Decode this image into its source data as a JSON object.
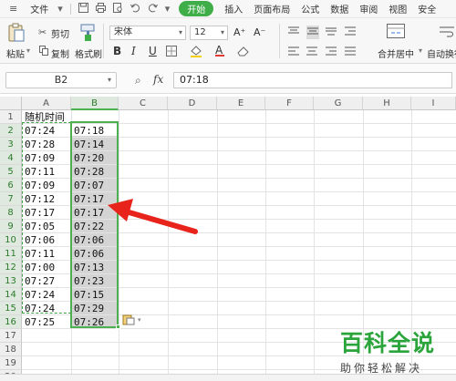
{
  "menubar": {
    "hamburger_icon": "≡",
    "file_label": "文件",
    "dropdown_icon": "▾",
    "quick_actions": [
      "save-icon",
      "print-icon",
      "preview-icon",
      "undo-icon",
      "redo-icon"
    ],
    "tabs": [
      "开始",
      "插入",
      "页面布局",
      "公式",
      "数据",
      "审阅",
      "视图",
      "安全"
    ],
    "active_tab": "开始",
    "accent_color": "#3fae49"
  },
  "ribbon": {
    "paste_label": "粘贴",
    "cut_label": "剪切",
    "copy_label": "复制",
    "format_painter_label": "格式刷",
    "font_name": "宋体",
    "font_size": "12",
    "font_grow": "A⁺",
    "font_shrink": "A⁻",
    "bold": "B",
    "italic": "I",
    "underline": "U",
    "font_color_letter": "A",
    "merge_label": "合并居中",
    "wrap_label": "自动换行"
  },
  "formula_bar": {
    "name_box": "B2",
    "formula_value": "07:18",
    "zoom_icon": "⌕",
    "fx_label": "fx"
  },
  "grid": {
    "columns": [
      "A",
      "B",
      "C",
      "D",
      "E",
      "F",
      "G",
      "H",
      "I"
    ],
    "rows": [
      "1",
      "2",
      "3",
      "4",
      "5",
      "6",
      "7",
      "8",
      "9",
      "10",
      "11",
      "12",
      "13",
      "14",
      "15",
      "16",
      "17",
      "18",
      "19",
      "20"
    ],
    "header_text": "随机时间",
    "col_a": [
      "07:24",
      "07:28",
      "07:09",
      "07:11",
      "07:09",
      "07:12",
      "07:17",
      "07:05",
      "07:06",
      "07:11",
      "07:00",
      "07:27",
      "07:24",
      "07:24",
      "07:25"
    ],
    "col_b": [
      "07:18",
      "07:14",
      "07:20",
      "07:28",
      "07:07",
      "07:17",
      "07:17",
      "07:22",
      "07:06",
      "07:06",
      "07:13",
      "07:23",
      "07:15",
      "07:29",
      "07:26"
    ],
    "selection_color": "#4caf50",
    "paste_options_icon": "paste-icon"
  },
  "annotation": {
    "arrow_color": "#e8231b"
  },
  "watermark": {
    "title": "百科全说",
    "subtitle": "助你轻松解决",
    "color": "#2aa43b"
  }
}
